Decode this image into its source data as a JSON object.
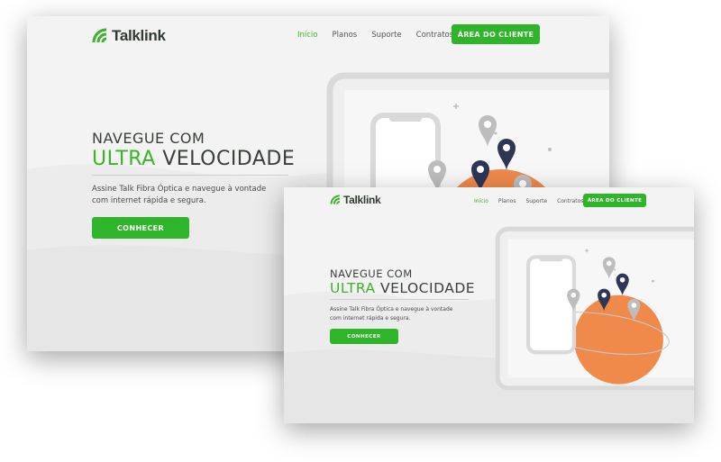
{
  "brand": {
    "name": "Talklink",
    "accent": "#3db329",
    "dark": "#333a33"
  },
  "nav": {
    "items": [
      "Início",
      "Planos",
      "Suporte",
      "Contratos"
    ],
    "active_index": 0,
    "cta": "ÁREA DO CLIENTE"
  },
  "hero": {
    "line1": "NAVEGUE COM",
    "line2_highlight": "ULTRA",
    "line2_rest": " VELOCIDADE",
    "subtitle_line1": "Assine Talk Fibra Óptica e navegue à vontade",
    "subtitle_line2": "com internet rápida e segura.",
    "button": "CONHECER"
  },
  "colors": {
    "orange": "#f08a4b",
    "pin_navy": "#2f3555",
    "pin_gray": "#bdbdbd",
    "device": "#d9d9d9"
  }
}
